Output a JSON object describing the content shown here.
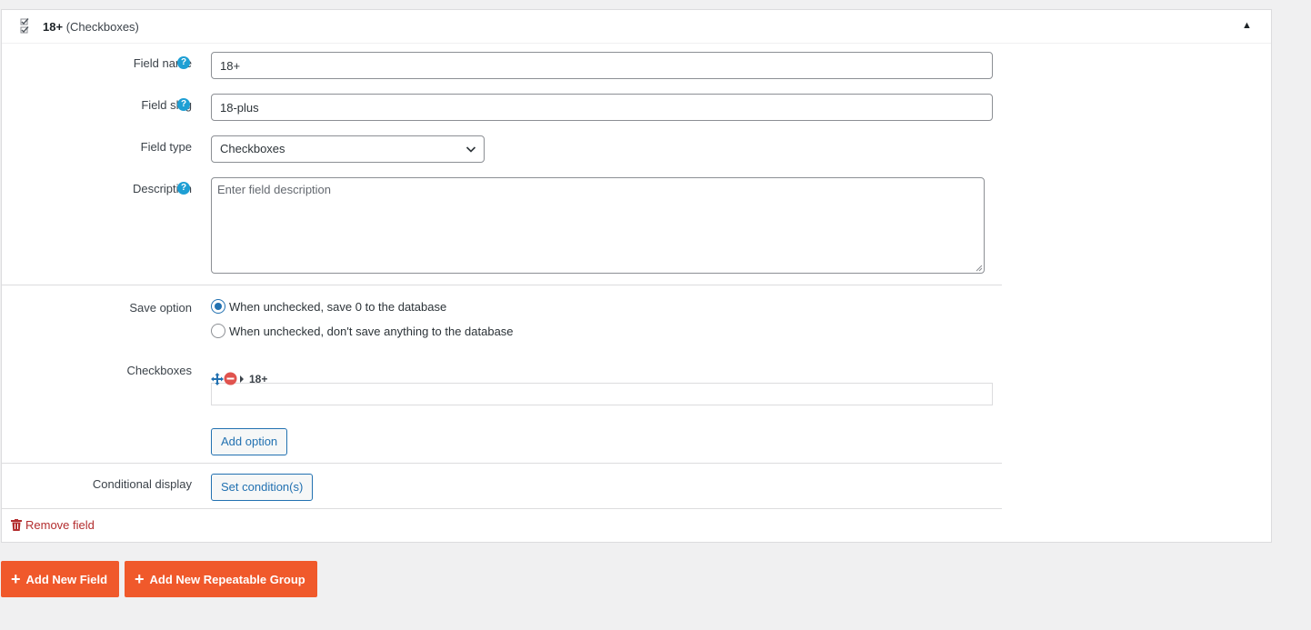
{
  "field_header": {
    "name": "18+",
    "type": "(Checkboxes)",
    "toggle_icon": "triangle-up-icon"
  },
  "field_name": {
    "label": "Field name",
    "value": "18+"
  },
  "field_slug": {
    "label": "Field slug",
    "value": "18-plus"
  },
  "field_type": {
    "label": "Field type",
    "selected": "Checkboxes"
  },
  "description": {
    "label": "Description",
    "placeholder": "Enter field description",
    "value": ""
  },
  "save_option": {
    "label": "Save option",
    "options": [
      {
        "label": "When unchecked, save 0 to the database",
        "checked": true
      },
      {
        "label": "When unchecked, don't save anything to the database",
        "checked": false
      }
    ]
  },
  "checkboxes": {
    "label": "Checkboxes",
    "options": [
      {
        "label": "18+"
      }
    ],
    "add_option_label": "Add option"
  },
  "conditional_display": {
    "label": "Conditional display",
    "button_label": "Set condition(s)"
  },
  "remove_field_label": "Remove field",
  "footer_buttons": {
    "add_new_field": "Add New Field",
    "add_new_repeatable_group": "Add New Repeatable Group"
  },
  "colors": {
    "accent_blue": "#2271b1",
    "help_blue": "#1e9fd4",
    "danger_red": "#b32d2e",
    "orange": "#f0592b"
  }
}
